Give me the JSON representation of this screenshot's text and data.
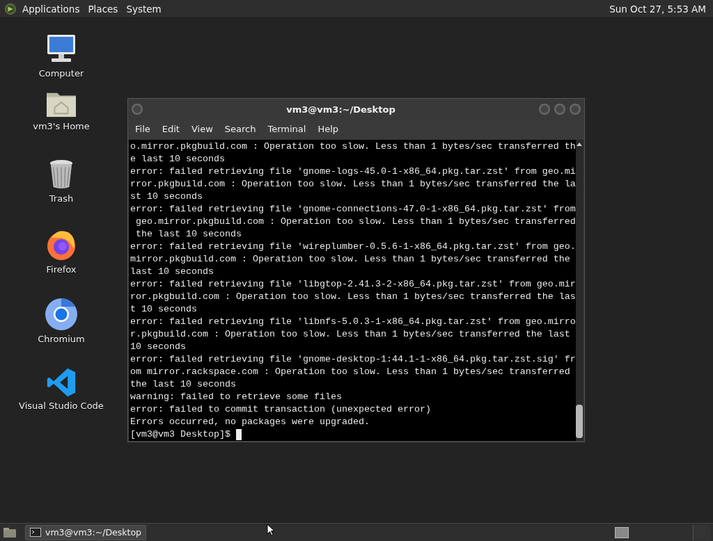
{
  "top_panel": {
    "menus": [
      "Applications",
      "Places",
      "System"
    ],
    "clock": "Sun Oct 27,  5:53 AM"
  },
  "desktop_icons": [
    {
      "label": "Computer"
    },
    {
      "label": "vm3's Home"
    },
    {
      "label": "Trash"
    },
    {
      "label": "Firefox"
    },
    {
      "label": "Chromium"
    },
    {
      "label": "Visual Studio Code"
    }
  ],
  "terminal": {
    "title": "vm3@vm3:~/Desktop",
    "menu": [
      "File",
      "Edit",
      "View",
      "Search",
      "Terminal",
      "Help"
    ],
    "lines": [
      "o.mirror.pkgbuild.com : Operation too slow. Less than 1 bytes/sec transferred th",
      "e last 10 seconds",
      "error: failed retrieving file 'gnome-logs-45.0-1-x86_64.pkg.tar.zst' from geo.mi",
      "rror.pkgbuild.com : Operation too slow. Less than 1 bytes/sec transferred the la",
      "st 10 seconds",
      "error: failed retrieving file 'gnome-connections-47.0-1-x86_64.pkg.tar.zst' from",
      " geo.mirror.pkgbuild.com : Operation too slow. Less than 1 bytes/sec transferred",
      " the last 10 seconds",
      "error: failed retrieving file 'wireplumber-0.5.6-1-x86_64.pkg.tar.zst' from geo.",
      "mirror.pkgbuild.com : Operation too slow. Less than 1 bytes/sec transferred the",
      "last 10 seconds",
      "error: failed retrieving file 'libgtop-2.41.3-2-x86_64.pkg.tar.zst' from geo.mir",
      "ror.pkgbuild.com : Operation too slow. Less than 1 bytes/sec transferred the las",
      "t 10 seconds",
      "error: failed retrieving file 'libnfs-5.0.3-1-x86_64.pkg.tar.zst' from geo.mirro",
      "r.pkgbuild.com : Operation too slow. Less than 1 bytes/sec transferred the last",
      "10 seconds",
      "error: failed retrieving file 'gnome-desktop-1:44.1-1-x86_64.pkg.tar.zst.sig' fr",
      "om mirror.rackspace.com : Operation too slow. Less than 1 bytes/sec transferred",
      "the last 10 seconds",
      "warning: failed to retrieve some files",
      "error: failed to commit transaction (unexpected error)",
      "Errors occurred, no packages were upgraded."
    ],
    "prompt": "[vm3@vm3 Desktop]$ "
  },
  "taskbar": {
    "tasks": [
      {
        "label": "vm3@vm3:~/Desktop",
        "selected": false
      }
    ]
  }
}
